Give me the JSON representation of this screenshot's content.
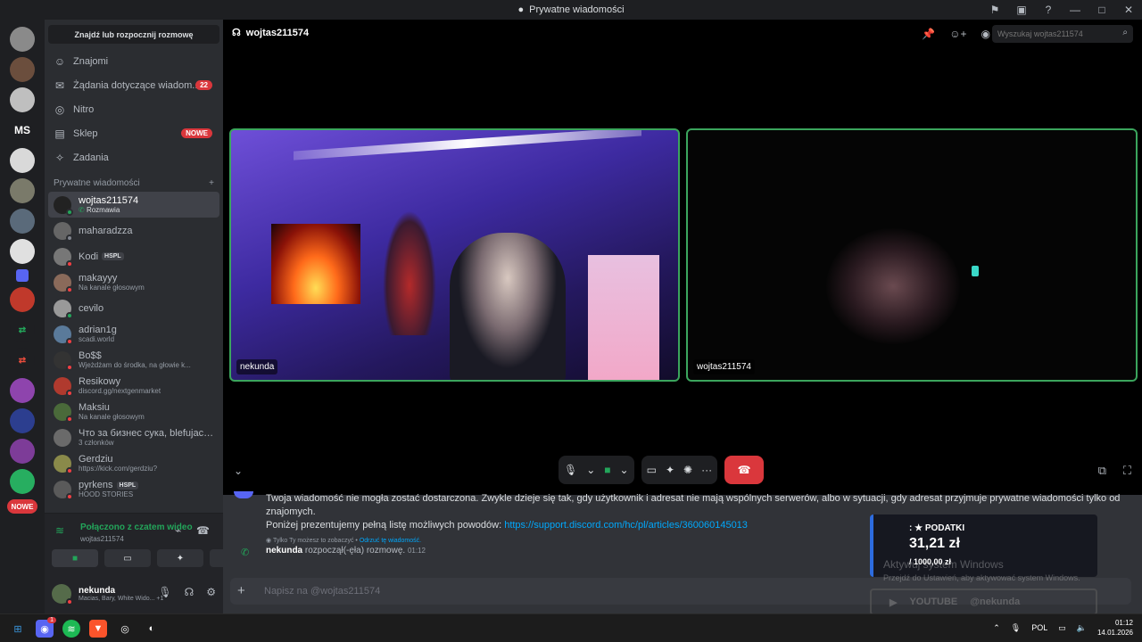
{
  "window": {
    "title": "Prywatne wiadomości"
  },
  "sidebar": {
    "find_label": "Znajdź lub rozpocznij rozmowę",
    "nav": [
      {
        "label": "Znajomi",
        "icon": "friends-icon"
      },
      {
        "label": "Żądania dotyczące wiadom...",
        "icon": "mail-icon",
        "badge": "22"
      },
      {
        "label": "Nitro",
        "icon": "nitro-icon"
      },
      {
        "label": "Sklep",
        "icon": "shop-icon",
        "badge": "NOWE"
      },
      {
        "label": "Zadania",
        "icon": "quests-icon"
      }
    ],
    "dm_header": "Prywatne wiadomości",
    "dms": [
      {
        "name": "wojtas211574",
        "sub": "Rozmawia",
        "status": "online"
      },
      {
        "name": "maharadzza",
        "sub": "",
        "status": "idle"
      },
      {
        "name": "Kodi",
        "tag": "HSPL",
        "sub": "",
        "status": "dnd"
      },
      {
        "name": "makayyy",
        "sub": "Na kanale głosowym",
        "status": "dnd"
      },
      {
        "name": "cevilo",
        "sub": "",
        "status": "online"
      },
      {
        "name": "adrian1g",
        "sub": "scadi.world",
        "status": "dnd"
      },
      {
        "name": "Bo$$",
        "sub": "Wjeżdżam do środka, na głowie k...",
        "status": "dnd"
      },
      {
        "name": "Resikowy",
        "sub": "discord.gg/nextgenmarket",
        "status": "dnd"
      },
      {
        "name": "Maksiu",
        "sub": "Na kanale głosowym",
        "status": "dnd"
      },
      {
        "name": "Что за бизнес сука, blefujacy...",
        "sub": "3 członków",
        "status": "none"
      },
      {
        "name": "Gerdziu",
        "sub": "https://kick.com/gerdziu?",
        "status": "dnd"
      },
      {
        "name": "pyrkens",
        "tag": "HSPL",
        "sub": "HOOD STORIES",
        "status": "dnd"
      }
    ]
  },
  "servers": {
    "ms_label": "MS",
    "nowe_label": "NOWE"
  },
  "voice": {
    "title": "Połączono z czatem wideo",
    "sub": "wojtas211574"
  },
  "user": {
    "name": "nekunda",
    "sub": "Macias, Bary, White Wido... +1"
  },
  "call": {
    "header": "wojtas211574",
    "search_placeholder": "Wyszukaj wojtas211574",
    "tile1_label": "nekunda",
    "tile2_label": "wojtas211574"
  },
  "chat": {
    "msg_text": "Twoja wiadomość nie mogła zostać dostarczona. Zwykle dzieje się tak, gdy użytkownik i adresat nie mają wspólnych serwerów, albo w sytuacji, gdy adresat przyjmuje prywatne wiadomości tylko od znajomych.",
    "msg_text2": "Poniżej prezentujemy pełną listę możliwych powodów:",
    "msg_link": "https://support.discord.com/hc/pl/articles/360060145013",
    "note": "Tylko Ty możesz to zobaczyć •",
    "note_link": "Odrzuć tę wiadomość.",
    "sys_user": "nekunda",
    "sys_text": "rozpoczął(-ęła) rozmowę.",
    "sys_time": "01:12",
    "composer_placeholder": "Napisz na @wojtas211574"
  },
  "overlay": {
    "title": ": ★ PODATKI",
    "value": "31,21 zł",
    "goal": "/ 1000,00 zł",
    "watermark1": "Aktywuj system Windows",
    "watermark2": "Przejdź do Ustawień, aby aktywować system Windows.",
    "yt_label": "YOUTUBE",
    "yt_handle": "@nekunda"
  },
  "taskbar": {
    "lang": "POL",
    "time": "01:12",
    "date": "14.01.2026",
    "discord_badge": "1"
  }
}
